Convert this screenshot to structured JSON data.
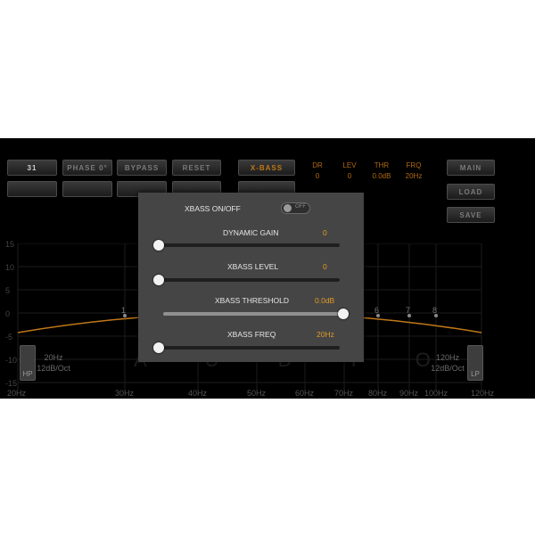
{
  "topbar": {
    "channel_value": "31",
    "phase_label": "PHASE 0°",
    "bypass_label": "BYPASS",
    "reset_label": "RESET",
    "xbass_label": "X-BASS",
    "main_label": "MAIN",
    "load_label": "LOAD",
    "save_label": "SAVE"
  },
  "stats": [
    {
      "label": "DR",
      "value": "0"
    },
    {
      "label": "LEV",
      "value": "0"
    },
    {
      "label": "THR",
      "value": "0.0dB"
    },
    {
      "label": "FRQ",
      "value": "20Hz"
    }
  ],
  "eq": {
    "y_ticks": [
      "15",
      "10",
      "5",
      "0",
      "-5",
      "-10",
      "-15"
    ],
    "x_ticks": [
      "20Hz",
      "30Hz",
      "40Hz",
      "50Hz",
      "60Hz",
      "70Hz",
      "80Hz",
      "90Hz",
      "100Hz",
      "120Hz"
    ],
    "points": [
      "1",
      "6",
      "7",
      "8"
    ],
    "hp": {
      "freq": "20Hz",
      "slope": "12dB/Oct",
      "label": "HP"
    },
    "lp": {
      "freq": "120Hz",
      "slope": "12dB/Oct",
      "label": "LP"
    },
    "watermark": "A U D I O"
  },
  "modal": {
    "toggle_label": "XBASS ON/OFF",
    "toggle_state": "OFF",
    "sliders": [
      {
        "label": "DYNAMIC GAIN",
        "value": "0",
        "level": 0.0
      },
      {
        "label": "XBASS LEVEL",
        "value": "0",
        "level": 0.0
      },
      {
        "label": "XBASS THRESHOLD",
        "value": "0.0dB",
        "level": 1.0
      },
      {
        "label": "XBASS FREQ",
        "value": "20Hz",
        "level": 0.0
      }
    ]
  },
  "colors": {
    "accent": "#e09a28",
    "modal_bg": "#454545",
    "app_bg": "#000000"
  }
}
